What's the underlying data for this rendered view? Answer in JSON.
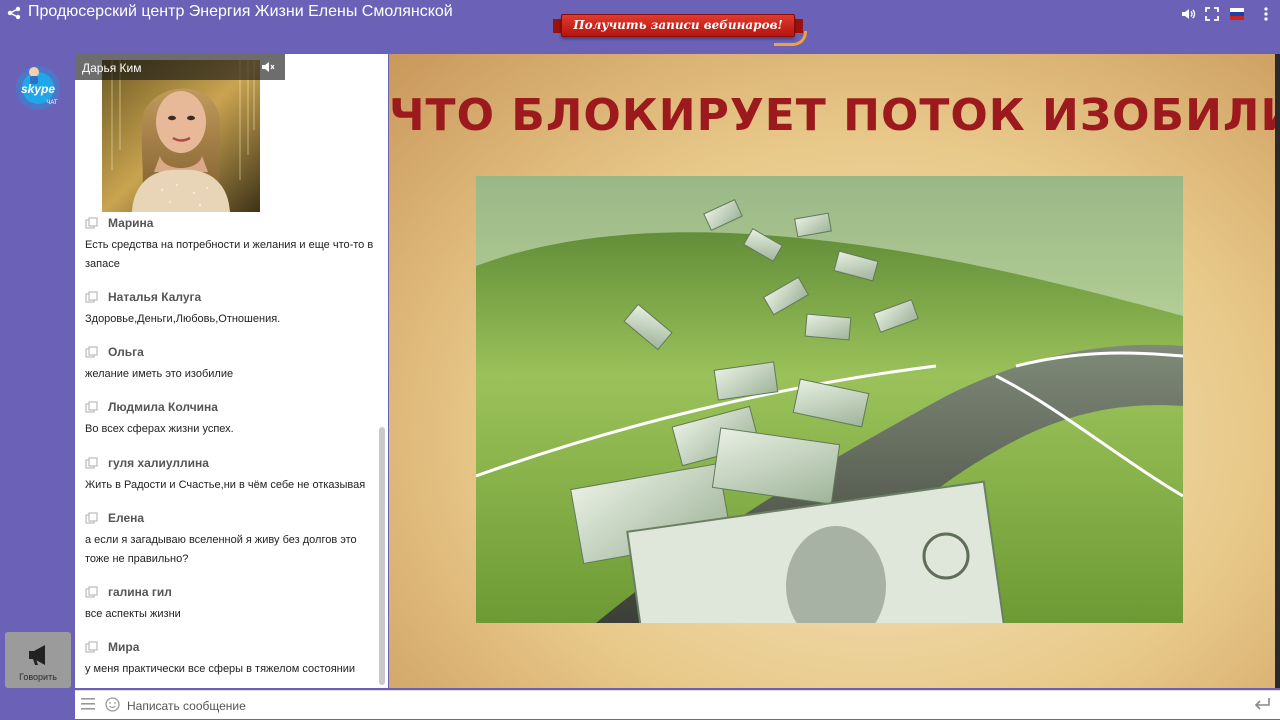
{
  "app": {
    "title": "Продюсерский центр Энергия Жизни Елены Смолянской"
  },
  "promo": {
    "label": "Получить записи вебинаров!"
  },
  "skype": {
    "logo": "skype",
    "sub": "ЧАТ"
  },
  "speak_button": {
    "label": "Говорить"
  },
  "video": {
    "presenter_name": "Дарья Ким"
  },
  "chat": {
    "messages": [
      {
        "author": "Марина",
        "text": "Есть средства на потребности и желания и еще что-то в запасе"
      },
      {
        "author": "Наталья Калуга",
        "text": "Здоровье,Деньги,Любовь,Отношения."
      },
      {
        "author": "Ольга",
        "text": "желание иметь это изобилие"
      },
      {
        "author": "Людмила Колчина",
        "text": "Во всех сферах жизни успех."
      },
      {
        "author": "гуля халиуллина",
        "text": "Жить в Радости и Счастье,ни в чём себе не отказывая"
      },
      {
        "author": "Елена",
        "text": "а если я загадываю вселенной я живу без долгов это тоже не правильно?"
      },
      {
        "author": "галина гил",
        "text": "все аспекты жизни"
      },
      {
        "author": "Мира",
        "text": "у меня практически все сферы в тяжелом состоянии"
      }
    ]
  },
  "slide": {
    "title": "ЧТО БЛОКИРУЕТ ПОТОК ИЗОБИЛИЯ"
  },
  "input": {
    "placeholder": "Написать сообщение"
  },
  "colors": {
    "background": "#6b62b8",
    "slide_title": "#9c1a1d",
    "promo": "#c8201a"
  },
  "icons": [
    "share-icon",
    "volume-icon",
    "fullscreen-icon",
    "russian-flag-icon",
    "skype-icon",
    "megaphone-icon",
    "speaker-icon",
    "user-icon",
    "menu-icon",
    "smile-icon",
    "enter-icon"
  ]
}
